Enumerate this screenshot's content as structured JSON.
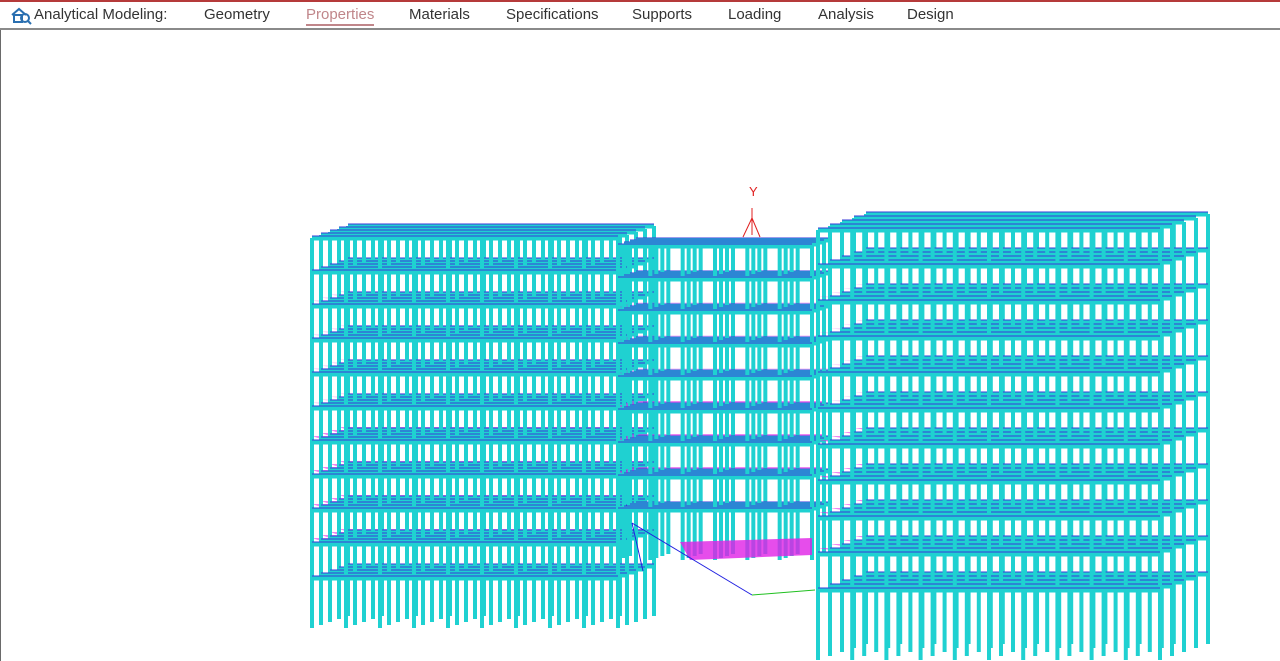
{
  "app": {
    "title": "Analytical Modeling:"
  },
  "tabs": [
    {
      "label": "Geometry",
      "active": false
    },
    {
      "label": "Properties",
      "active": true
    },
    {
      "label": "Materials",
      "active": false
    },
    {
      "label": "Specifications",
      "active": false
    },
    {
      "label": "Supports",
      "active": false
    },
    {
      "label": "Loading",
      "active": false
    },
    {
      "label": "Analysis",
      "active": false
    },
    {
      "label": "Design",
      "active": false
    }
  ],
  "viewport": {
    "axis_label_y": "Y",
    "colors": {
      "members": "#1fd1d1",
      "plates": "#e020e6",
      "beam_edge": "#3a3ad8",
      "axis_y": "#e02020",
      "axis_x": "#20c020",
      "axis_z": "#2020e0"
    }
  }
}
